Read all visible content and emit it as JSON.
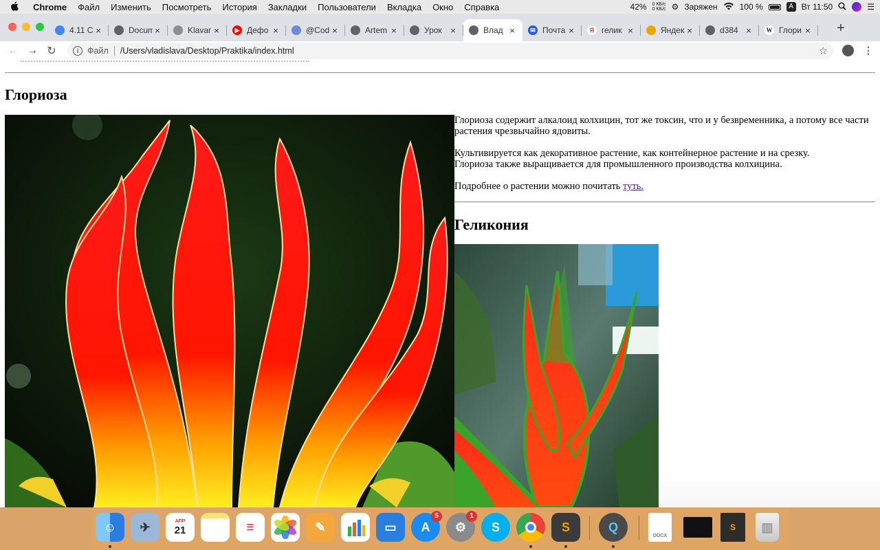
{
  "menubar": {
    "apple": "",
    "app_name": "Chrome",
    "items": [
      "Файл",
      "Изменить",
      "Посмотреть",
      "История",
      "Закладки",
      "Пользователи",
      "Вкладка",
      "Окно",
      "Справка"
    ],
    "status": {
      "ram_percent": "42%",
      "net_up": "0 КБ/с",
      "net_down": "0 КБ/с",
      "charging": "Заряжен",
      "battery": "100 %",
      "input_lang": "A",
      "clock": "Вт 11:50"
    }
  },
  "browser": {
    "tabs": [
      {
        "title": "4.11 С",
        "favicon": "chrome-icon",
        "color": "#4285f4",
        "glyph": ""
      },
      {
        "title": "Docum",
        "favicon": "globe-icon",
        "color": "#5f6368",
        "glyph": ""
      },
      {
        "title": "Klavar",
        "favicon": "page-icon",
        "color": "#8d8d8d",
        "glyph": ""
      },
      {
        "title": "Дефо",
        "favicon": "youtube-icon",
        "color": "#ff0000",
        "glyph": "▶"
      },
      {
        "title": "@Cod",
        "favicon": "discord-icon",
        "color": "#7289da",
        "glyph": ""
      },
      {
        "title": "Artem",
        "favicon": "globe-icon",
        "color": "#5f6368",
        "glyph": ""
      },
      {
        "title": "Урок",
        "favicon": "globe-icon",
        "color": "#5f6368",
        "glyph": ""
      },
      {
        "title": "Влад",
        "favicon": "globe-icon",
        "color": "#5f6368",
        "glyph": "",
        "active": true
      },
      {
        "title": "Почта",
        "favicon": "mail-icon",
        "color": "#2a5bd7",
        "glyph": "✉"
      },
      {
        "title": "гелик",
        "favicon": "yandex-icon",
        "color": "#ffffff",
        "glyph": "Я"
      },
      {
        "title": "Яндек",
        "favicon": "images-icon",
        "color": "#f0a500",
        "glyph": ""
      },
      {
        "title": "d384",
        "favicon": "globe-icon",
        "color": "#5f6368",
        "glyph": ""
      },
      {
        "title": "Глори",
        "favicon": "wikipedia-icon",
        "color": "#ffffff",
        "glyph": "W"
      }
    ],
    "new_tab": "+",
    "address": {
      "info": "i",
      "protocol_label": "Файл",
      "url": "/Users/vladislava/Desktop/Praktika/index.html"
    }
  },
  "page": {
    "section1": {
      "title": "Глориоза",
      "p1": "Глориоза содержит алкалоид колхицин, тот же токсин, что и у безвременника, а потому все части растения чрезвычайно ядовиты.",
      "p2_line1": "Культивируется как декоративное растение, как контейнерное растение и на срезку.",
      "p2_line2": "Глориоза также выращивается для промышленного производства колхицина.",
      "p3_text": "Подробнее о растении можно почитать ",
      "p3_link": "туть."
    },
    "section2": {
      "title": "Геликония"
    }
  },
  "dock": {
    "calendar_month": "АПР",
    "calendar_day": "21",
    "appstore_badge": "5",
    "prefs_badge": "1",
    "docx_label": "DOCX",
    "items": [
      {
        "name": "finder-icon",
        "color": "#3b8ee8"
      },
      {
        "name": "mail-app-icon",
        "color": "#6aa0d8"
      },
      {
        "name": "calendar-icon",
        "color": "#ffffff"
      },
      {
        "name": "notes-icon",
        "color": "#f7e27a"
      },
      {
        "name": "reminders-icon",
        "color": "#ffffff"
      },
      {
        "name": "photos-icon",
        "color": "#ffffff"
      },
      {
        "name": "pages-icon",
        "color": "#f4a73c"
      },
      {
        "name": "numbers-icon",
        "color": "#2fb24a"
      },
      {
        "name": "keynote-icon",
        "color": "#2a7de1"
      },
      {
        "name": "app-store-icon",
        "color": "#1a8cf0"
      },
      {
        "name": "system-preferences-icon",
        "color": "#888888"
      },
      {
        "name": "skype-icon",
        "color": "#00aff0"
      },
      {
        "name": "chrome-icon",
        "color": "#ffffff"
      },
      {
        "name": "sublime-text-icon",
        "color": "#3b3b3b"
      },
      {
        "name": "quicktime-icon",
        "color": "#4a4a4a"
      },
      {
        "name": "docx-file-icon",
        "color": "#ffffff"
      },
      {
        "name": "screen-thumbnail-icon",
        "color": "#111111"
      },
      {
        "name": "sublime-file-icon",
        "color": "#2c2c2c"
      },
      {
        "name": "trash-icon",
        "color": "#d9d9d9"
      }
    ]
  }
}
